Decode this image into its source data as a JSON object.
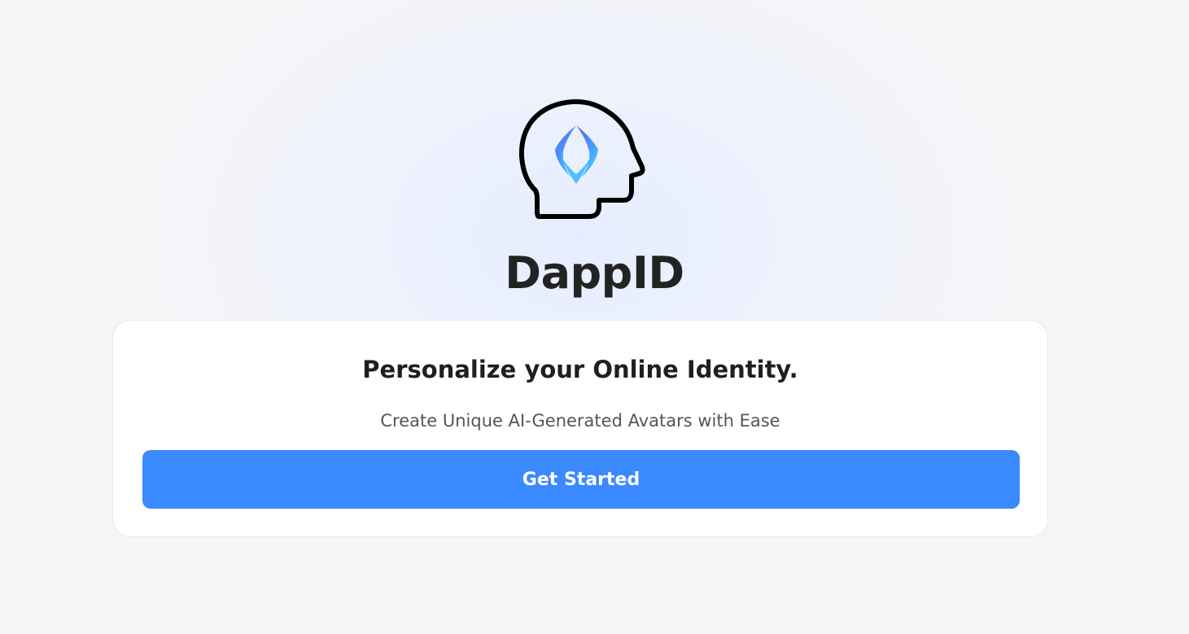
{
  "brand": {
    "name": "DappID",
    "logo_icon": "head-with-gem-icon",
    "gradient": [
      "#5b5cf0",
      "#41c7ff"
    ]
  },
  "hero": {
    "headline": "Personalize your Online Identity.",
    "subheadline": "Create Unique AI-Generated Avatars with Ease"
  },
  "cta": {
    "label": "Get Started",
    "color": "#3a89ff"
  }
}
